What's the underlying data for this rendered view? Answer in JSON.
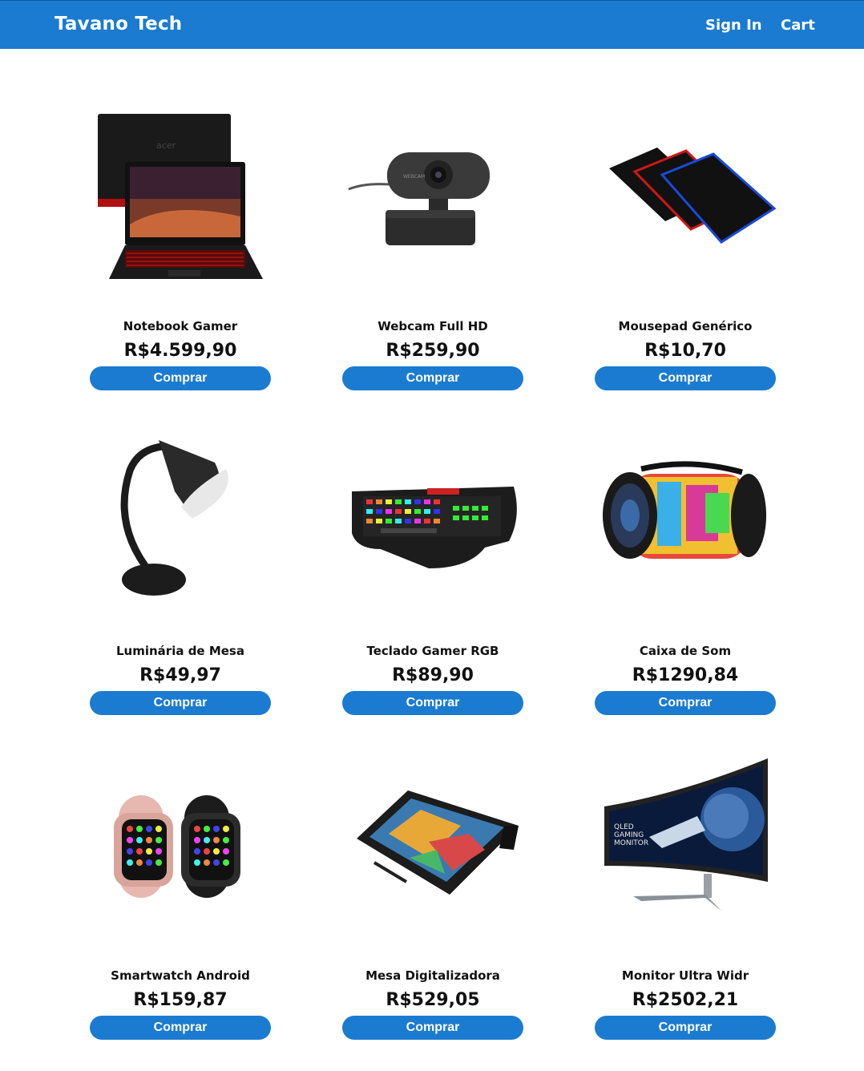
{
  "header": {
    "brand": "Tavano Tech",
    "sign_in": "Sign In",
    "cart": "Cart",
    "accent_color": "#1b7bd0"
  },
  "products": [
    {
      "name": "Notebook Gamer",
      "price": "R$4.599,90",
      "button": "Comprar",
      "image_icon": "laptop-icon"
    },
    {
      "name": "Webcam Full HD",
      "price": "R$259,90",
      "button": "Comprar",
      "image_icon": "webcam-icon"
    },
    {
      "name": "Mousepad Genérico",
      "price": "R$10,70",
      "button": "Comprar",
      "image_icon": "mousepad-icon"
    },
    {
      "name": "Luminária de Mesa",
      "price": "R$49,97",
      "button": "Comprar",
      "image_icon": "desk-lamp-icon"
    },
    {
      "name": "Teclado Gamer RGB",
      "price": "R$89,90",
      "button": "Comprar",
      "image_icon": "keyboard-icon"
    },
    {
      "name": "Caixa de Som",
      "price": "R$1290,84",
      "button": "Comprar",
      "image_icon": "speaker-icon"
    },
    {
      "name": "Smartwatch Android",
      "price": "R$159,87",
      "button": "Comprar",
      "image_icon": "smartwatch-icon"
    },
    {
      "name": "Mesa Digitalizadora",
      "price": "R$529,05",
      "button": "Comprar",
      "image_icon": "drawing-tablet-icon"
    },
    {
      "name": "Monitor Ultra Widr",
      "price": "R$2502,21",
      "button": "Comprar",
      "image_icon": "monitor-icon"
    }
  ]
}
